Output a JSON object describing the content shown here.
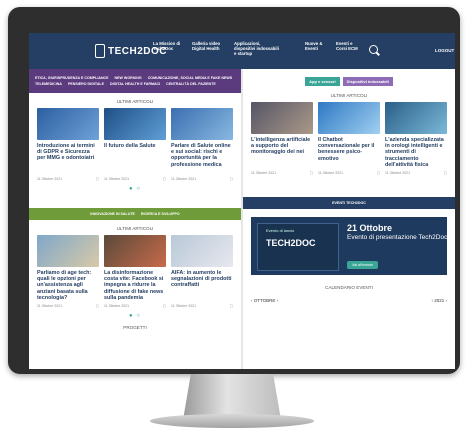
{
  "header": {
    "logo": "TECH2DOC",
    "nav": [
      "La Mission di Tech2Doc",
      "Galleria video Digital Health",
      "Applicazioni, dispositivi indossabili e startup",
      "Nuove & Eventi",
      "Eventi e Corsi ECM"
    ],
    "login": "LOGOUT"
  },
  "left": {
    "categories": [
      "Etica, giurisprudenza e compliance",
      "New working",
      "Comunicazione, social media e fake news",
      "Telemedicina",
      "Pensiero digitale",
      "Digital health e farmaci",
      "Centralità del paziente"
    ],
    "section1": {
      "title": "ULTIMI ARTICOLI",
      "cards": [
        {
          "title": "Introduzione ai termini di GDPR e Sicurezza per MMG e odontoiatri",
          "date": "11 Ottobre 2021"
        },
        {
          "title": "Il futuro della Salute",
          "date": "11 Ottobre 2021"
        },
        {
          "title": "Parlare di Salute online e sui social: rischi e opportunità per la professione medica",
          "date": "11 Ottobre 2021"
        }
      ]
    },
    "bar2": [
      "Innovazione in salute",
      "Ricerca e sviluppo"
    ],
    "section2": {
      "title": "ULTIMI ARTICOLI",
      "cards": [
        {
          "title": "Parliamo di age tech: quali le opzioni per un'assistenza agli anziani basata sulla tecnologia?",
          "date": "11 Ottobre 2021"
        },
        {
          "title": "La disinformazione costa vite: Facebook si impegna a ridurre la diffusione di fake news sulla pandemia",
          "date": "11 Ottobre 2021"
        },
        {
          "title": "AIFA: in aumento le segnalazioni di prodotti contraffatti",
          "date": "11 Ottobre 2021"
        }
      ]
    },
    "footer_label": "PROGETTI"
  },
  "right": {
    "categories": [
      "App e sensori",
      "Dispositivi indossabili"
    ],
    "section1": {
      "title": "ULTIMI ARTICOLI",
      "cards": [
        {
          "title": "L'intelligenza artificiale a supporto del monitoraggio dei nei",
          "date": "11 Ottobre 2021"
        },
        {
          "title": "Il Chatbot conversazionale per il benessere psico-emotivo",
          "date": "11 Ottobre 2021"
        },
        {
          "title": "L'azienda specializzata in orologi intelligenti e strumenti di tracciamento dell'attività fisica",
          "date": "11 Ottobre 2021"
        }
      ]
    },
    "events_bar": "EVENTI TECH2DOC",
    "event": {
      "image_top": "Evento di lancio",
      "image_brand": "TECH2DOC",
      "date": "21 Ottobre",
      "title": "Evento di presentazione Tech2Doc",
      "button": "Vai all'evento"
    },
    "calendar": {
      "title": "CALENDARIO EVENTI",
      "month": "OTTOBRE",
      "year": "2021"
    }
  },
  "colors": {
    "navy": "#243f63",
    "purple": "#5b3a7e",
    "teal": "#3aa596",
    "green": "#6f9b3a"
  }
}
